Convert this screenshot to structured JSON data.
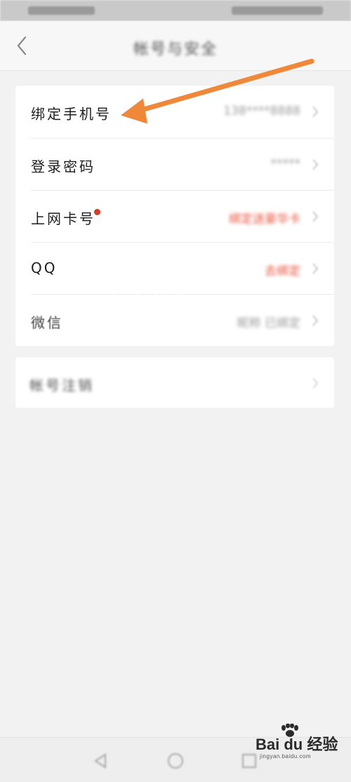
{
  "header": {
    "title": "帐号与安全"
  },
  "rows": [
    {
      "label": "绑定手机号",
      "value": "138****8888",
      "value_color": "gray"
    },
    {
      "label": "登录密码",
      "value": "*****",
      "value_color": "gray"
    },
    {
      "label": "上网卡号",
      "value": "绑定送豪华卡",
      "value_color": "red",
      "badge": "red-dot"
    },
    {
      "label": "QQ",
      "value": "去绑定",
      "value_color": "red"
    },
    {
      "label": "微信",
      "value": "昵称 已绑定",
      "value_color": "gray"
    }
  ],
  "section2": {
    "label": "帐号注销"
  },
  "watermark": "百度",
  "baidu_logo": {
    "text": "Bai du 经验",
    "url_text": "jingyan.baidu.com"
  },
  "annotation": {
    "color": "#f0883a",
    "points_to": "绑定手机号"
  },
  "colors": {
    "background": "#f2f2f2",
    "card": "#ffffff",
    "accent_red": "#e8503a",
    "red_dot": "#d63a2a"
  },
  "icons": [
    "back-arrow-icon",
    "chevron-right-icon",
    "nav-back-icon",
    "nav-home-icon",
    "nav-recent-icon",
    "baidu-paw-icon"
  ]
}
